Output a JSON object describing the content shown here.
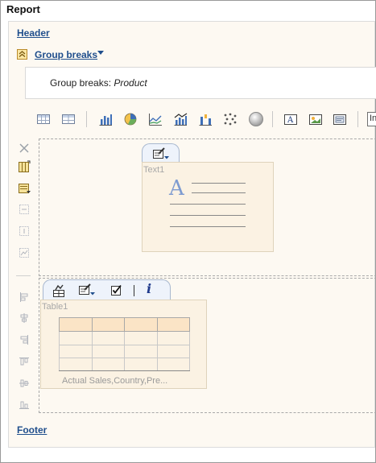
{
  "report": {
    "title": "Report",
    "header_label": "Header",
    "group_breaks_label": "Group breaks",
    "group_breaks_prefix": "Group breaks: ",
    "group_breaks_field": "Product",
    "footer_label": "Footer"
  },
  "toolbar": {
    "icons": [
      "crosstab-icon",
      "table-icon",
      "bar-chart-icon",
      "pie-chart-icon",
      "line-chart-icon",
      "combo-chart-icon",
      "waterfall-chart-icon",
      "scatter-chart-icon",
      "gauge-icon",
      "text-object-icon",
      "image-object-icon",
      "graphic-object-icon"
    ],
    "cell_input_value": "In"
  },
  "side_toolbar": {
    "icons": [
      "delete-icon",
      "column-layout-icon",
      "properties-icon",
      "merge-rows-icon",
      "merge-cols-icon",
      "chart-cell-icon",
      "align-left-icon",
      "align-center-icon",
      "align-right-icon",
      "align-top-icon",
      "align-middle-icon",
      "align-bottom-icon"
    ]
  },
  "text_object": {
    "label": "Text1",
    "glyph": "A"
  },
  "table_object": {
    "label": "Table1",
    "caption": "Actual Sales,Country,Pre..."
  },
  "colors": {
    "link": "#1f4e8c",
    "canvas": "#fdf9f2",
    "object_fill": "#fbf2e3",
    "header_row": "#fbe4c6"
  }
}
